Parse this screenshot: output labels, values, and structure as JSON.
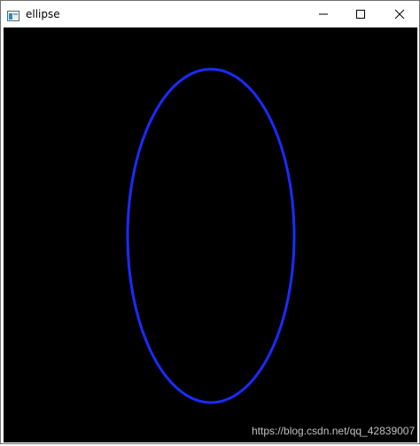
{
  "window": {
    "title": "ellipse",
    "icon": "app-window-icon",
    "controls": [
      "minimize-icon",
      "maximize-icon",
      "close-icon"
    ]
  },
  "canvas": {
    "background": "#000000",
    "ellipse_color": "#1a2bff"
  },
  "watermark": "https://blog.csdn.net/qq_42839007"
}
